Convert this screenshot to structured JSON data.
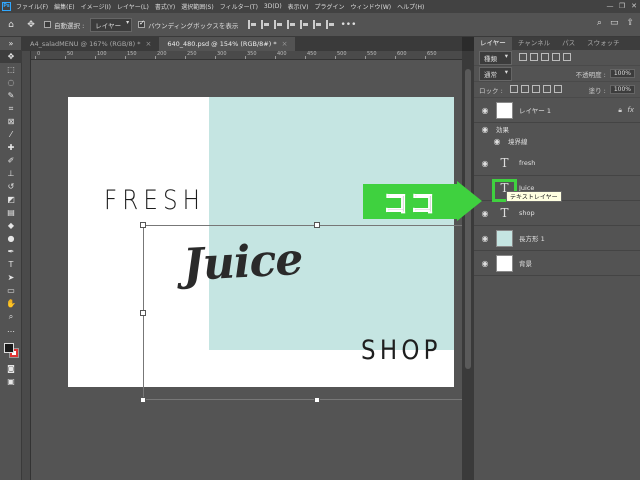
{
  "menu": {
    "logo": "Ps",
    "items": [
      "ファイル(F)",
      "編集(E)",
      "イメージ(I)",
      "レイヤー(L)",
      "書式(Y)",
      "選択範囲(S)",
      "フィルター(T)",
      "3D(D)",
      "表示(V)",
      "プラグイン",
      "ウィンドウ(W)",
      "ヘルプ(H)"
    ],
    "window_controls": [
      "—",
      "❐",
      "✕"
    ]
  },
  "options": {
    "auto_select_label": "自動選択 :",
    "auto_select_checked": false,
    "auto_select_target": "レイヤー",
    "bounding_box_label": "バウンディングボックスを表示",
    "bounding_box_checked": true,
    "more": "•••"
  },
  "tabs": [
    {
      "label": "A4_saladMENU @ 167% (RGB/8) *",
      "active": false
    },
    {
      "label": "640_480.psd @ 154% (RGB/8#) *",
      "active": true
    }
  ],
  "ruler": {
    "top_numbers": [
      "0",
      "50",
      "100",
      "150",
      "200",
      "250",
      "300",
      "350",
      "400",
      "450",
      "500",
      "550",
      "600",
      "650"
    ]
  },
  "canvas": {
    "text_fresh": "FRESH",
    "text_juice": "Juice",
    "text_shop": "SHOP",
    "mint_color": "#c5e5e2"
  },
  "panel": {
    "tabs": [
      "レイヤー",
      "チャンネル",
      "パス",
      "スウォッチ"
    ],
    "active_tab": "レイヤー",
    "filter_label": "種類",
    "blend_mode": "通常",
    "opacity_label": "不透明度 :",
    "opacity_value": "100%",
    "lock_label": "ロック :",
    "fill_label": "塗り :",
    "fill_value": "100%",
    "layers": [
      {
        "name": "レイヤー 1",
        "kind": "pixel",
        "fx": "fx",
        "sub": [
          "効果",
          "境界線"
        ]
      },
      {
        "name": "fresh",
        "kind": "text"
      },
      {
        "name": "Juice",
        "kind": "text",
        "tooltip": "テキストレイヤー"
      },
      {
        "name": "shop",
        "kind": "text"
      },
      {
        "name": "長方形 1",
        "kind": "shape"
      },
      {
        "name": "背景",
        "kind": "pixel"
      }
    ]
  },
  "callout": {
    "text": "ココ",
    "color": "#3fd13f"
  }
}
